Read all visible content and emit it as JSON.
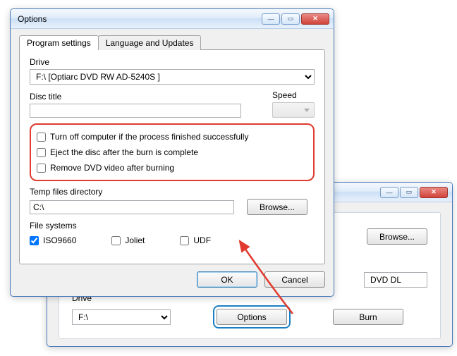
{
  "fg": {
    "title": "Options",
    "tabs": {
      "program": "Program settings",
      "lang": "Language and Updates"
    },
    "drive": {
      "label": "Drive",
      "value": "F:\\ [Optiarc DVD RW AD-5240S ]"
    },
    "disc": {
      "label": "Disc title",
      "value": ""
    },
    "speed": {
      "label": "Speed"
    },
    "chk1": "Turn off computer if the process finished successfully",
    "chk2": "Eject the disc after the burn is complete",
    "chk3": "Remove DVD video after burning",
    "temp": {
      "label": "Temp files directory",
      "value": "C:\\",
      "browse": "Browse..."
    },
    "fs": {
      "label": "File systems",
      "iso": "ISO9660",
      "joliet": "Joliet",
      "udf": "UDF"
    },
    "ok": "OK",
    "cancel": "Cancel"
  },
  "bg": {
    "browse": "Browse...",
    "dvddl": "DVD DL",
    "drive": {
      "label": "Drive",
      "value": "F:\\"
    },
    "options": "Options",
    "burn": "Burn"
  }
}
